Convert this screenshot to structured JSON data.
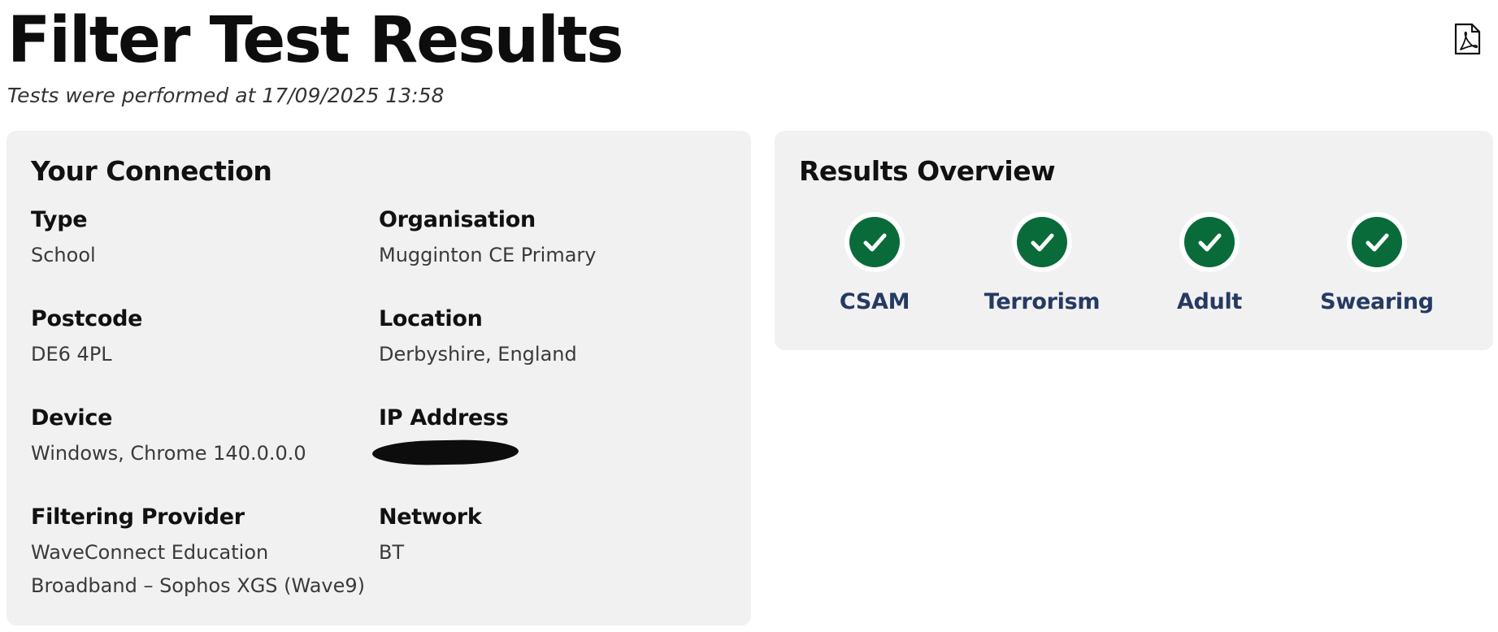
{
  "header": {
    "title": "Filter Test Results",
    "subtitle": "Tests were performed at 17/09/2025 13:58",
    "pdf_icon": "pdf-icon"
  },
  "connection": {
    "title": "Your Connection",
    "fields": {
      "type": {
        "label": "Type",
        "value": "School"
      },
      "organisation": {
        "label": "Organisation",
        "value": "Mugginton CE Primary"
      },
      "postcode": {
        "label": "Postcode",
        "value": "DE6 4PL"
      },
      "location": {
        "label": "Location",
        "value": "Derbyshire, England"
      },
      "device": {
        "label": "Device",
        "value": "Windows, Chrome 140.0.0.0"
      },
      "ip_address": {
        "label": "IP Address"
      },
      "filtering_provider": {
        "label": "Filtering Provider",
        "value": "WaveConnect Education Broadband – Sophos XGS (Wave9)"
      },
      "network": {
        "label": "Network",
        "value": "BT"
      }
    }
  },
  "results": {
    "title": "Results Overview",
    "items": [
      {
        "label": "CSAM",
        "icon": "check-icon",
        "status_color": "#0a6b3a"
      },
      {
        "label": "Terrorism",
        "icon": "check-icon",
        "status_color": "#0a6b3a"
      },
      {
        "label": "Adult",
        "icon": "check-icon",
        "status_color": "#0a6b3a"
      },
      {
        "label": "Swearing",
        "icon": "check-icon",
        "status_color": "#0a6b3a"
      }
    ]
  },
  "colors": {
    "card_background": "#f1f1f1",
    "success": "#0a6b3a",
    "result_label": "#253a63"
  }
}
